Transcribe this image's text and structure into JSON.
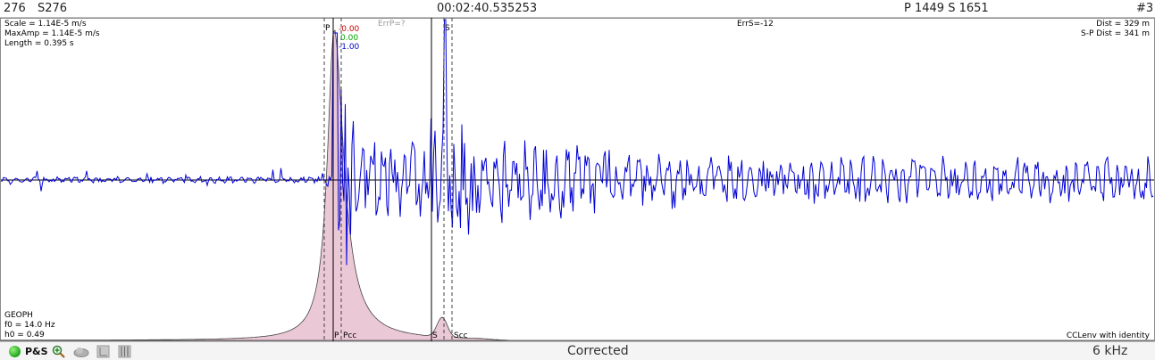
{
  "header": {
    "channel": "276",
    "station": "S276",
    "time": "00:02:40.535253",
    "picks": "P 1449 S 1651",
    "index": "#3"
  },
  "info_left": {
    "scale": "Scale = 1.14E-5 m/s",
    "maxamp": "MaxAmp = 1.14E-5 m/s",
    "length": "Length = 0.395 s"
  },
  "info_right": {
    "dist": "Dist = 329 m",
    "sp_dist": "S-P Dist = 341 m"
  },
  "errors": {
    "errp": "ErrP=?",
    "errs": "ErrS=-12"
  },
  "components": {
    "first": "-0.00",
    "second": "0.00",
    "third": "-1.00"
  },
  "sensor": {
    "type": "GEOPH",
    "f0": "f0 = 14.0 Hz",
    "h0": "h0 = 0.49"
  },
  "markers": {
    "p": "P",
    "pcc": "Pcc",
    "s": "S",
    "scc": "Scc",
    "p_top": "P",
    "s_top": "S"
  },
  "footer_right": "CCLenv with identity",
  "bottombar": {
    "ps_label": "P&S",
    "status": "Corrected",
    "rate": "6 kHz"
  },
  "icons": [
    "green-status-icon",
    "zoom-in-icon",
    "cloud-icon",
    "component-icon",
    "channels-icon"
  ],
  "colors": {
    "trace": "#0000d6",
    "envelope_fill": "#ebc8d6",
    "envelope_line": "#444444",
    "comp1": "#cc0000",
    "comp2": "#00a000",
    "comp3": "#0000cc"
  }
}
